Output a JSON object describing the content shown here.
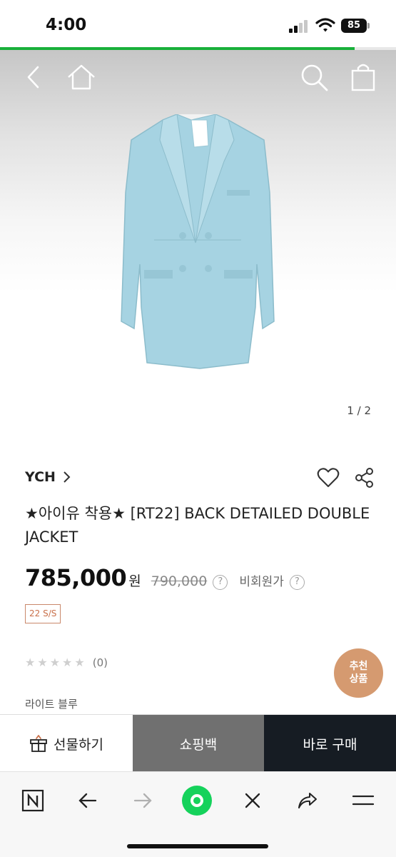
{
  "status_bar": {
    "time": "4:00",
    "battery": "85"
  },
  "page_progress": 0.895,
  "header": {
    "icons": {
      "back": "chevron-left-icon",
      "home": "home-icon",
      "search": "search-icon",
      "cart": "shopping-bag-icon"
    }
  },
  "product": {
    "image_counter": "1 / 2",
    "brand": "YCH",
    "title": "★아이유 착용★ [RT22] BACK DETAILED DOUBLE JACKET",
    "price": "785,000",
    "currency": "원",
    "original_price": "790,000",
    "price_help": "?",
    "member_price_label": "비회원가",
    "member_price_help": "?",
    "season_tag": "22 S/S",
    "rating": {
      "stars": 0,
      "max_stars": 5,
      "review_count": "(0)"
    },
    "color_label": "라이트 블루"
  },
  "recommend_badge": {
    "line1": "추천",
    "line2": "상품"
  },
  "purchase_bar": {
    "gift_label": "선물하기",
    "cart_label": "쇼핑백",
    "buy_label": "바로 구매"
  },
  "colors": {
    "accent_green": "#18b03a",
    "buy_button": "#161c23",
    "cart_button": "#707070",
    "jacket": "#a6d3e2",
    "recommend_badge": "#d59a70",
    "season_tag": "#c9704a"
  }
}
